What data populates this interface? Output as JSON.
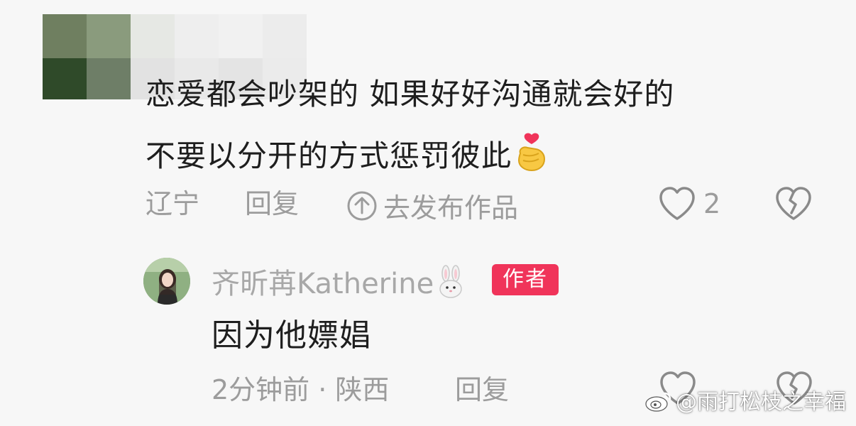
{
  "comment": {
    "line1": "恋爱都会吵架的  如果好好沟通就会好的",
    "line2": "不要以分开的方式惩罚彼此",
    "emoji_icon": "finger-heart-icon",
    "location": "辽宁",
    "reply_label": "回复",
    "post_work_label": "去发布作品",
    "like_count": "2",
    "colors": {
      "text": "#1e1e1e",
      "meta": "#9c9c9c"
    }
  },
  "reply": {
    "author": "齐昕苒Katherine",
    "author_suffix_icon": "rabbit-icon",
    "badge": "作者",
    "badge_color": "#f0345a",
    "text": "因为他嫖娼",
    "time_location": "2分钟前 · 陕西",
    "reply_label": "回复"
  },
  "watermark": {
    "text": "@雨打松枝之幸福",
    "icon": "weibo-logo-icon"
  }
}
